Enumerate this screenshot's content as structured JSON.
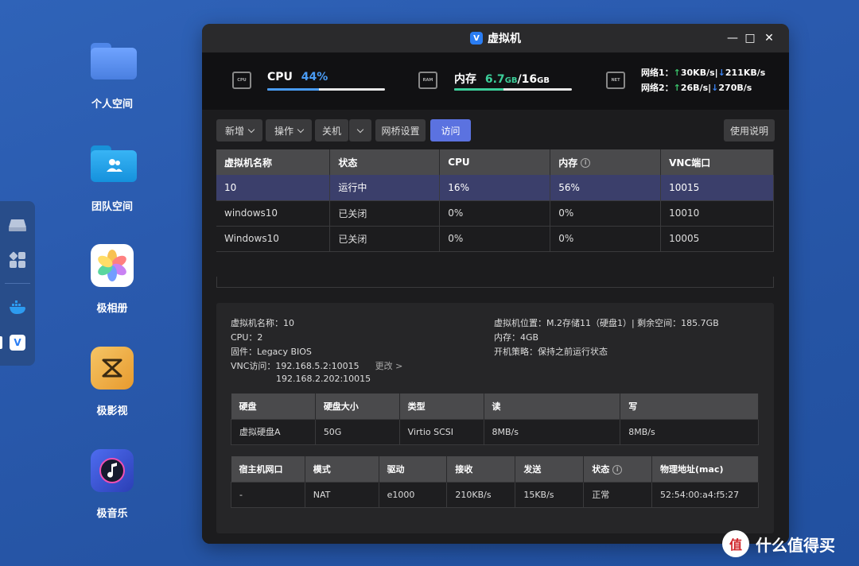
{
  "desktop": {
    "icons": [
      {
        "label": "个人空间",
        "icon": "folder-icon"
      },
      {
        "label": "团队空间",
        "icon": "team-folder-icon"
      },
      {
        "label": "极相册",
        "icon": "photos-icon"
      },
      {
        "label": "极影视",
        "icon": "video-icon"
      },
      {
        "label": "极音乐",
        "icon": "music-icon"
      }
    ]
  },
  "window": {
    "title": "虚拟机",
    "controls": {
      "minimize": "—",
      "maximize": "□",
      "close": "✕"
    }
  },
  "stats": {
    "cpu": {
      "label": "CPU",
      "value": "44%",
      "percent": 44,
      "chip": "CPU"
    },
    "memory": {
      "label": "内存",
      "used": "6.7",
      "used_unit": "GB",
      "sep": "/",
      "total": "16",
      "total_unit": "GB",
      "percent": 42,
      "chip": "RAM"
    },
    "network": {
      "chip": "NET",
      "net1": {
        "label": "网络1：",
        "up_arrow": "↑",
        "up": "30KB/s",
        "sep": "|",
        "down_arrow": "↓",
        "down": "211KB/s"
      },
      "net2": {
        "label": "网络2：",
        "up_arrow": "↑",
        "up": "26B/s",
        "sep": "|",
        "down_arrow": "↓",
        "down": "270B/s"
      }
    }
  },
  "toolbar": {
    "new": "新增",
    "action": "操作",
    "shutdown": "关机",
    "bridge": "网桥设置",
    "visit": "访问",
    "help": "使用说明"
  },
  "vm_table": {
    "headers": [
      "虚拟机名称",
      "状态",
      "CPU",
      "内存",
      "VNC端口"
    ],
    "rows": [
      [
        "10",
        "运行中",
        "16%",
        "56%",
        "10015"
      ],
      [
        "windows10",
        "已关闭",
        "0%",
        "0%",
        "10010"
      ],
      [
        "Windows10",
        "已关闭",
        "0%",
        "0%",
        "10005"
      ]
    ]
  },
  "detail": {
    "name": "虚拟机名称：10",
    "cpu": "CPU：2",
    "firmware": "固件：Legacy BIOS",
    "vnc": "VNC访问：192.168.5.2:10015",
    "vnc_change": "更改 >",
    "vnc2": "192.168.2.202:10015",
    "location": "虚拟机位置：M.2存储11（硬盘1）| 剩余空间：185.7GB",
    "memory": "内存：4GB",
    "boot": "开机策略：保持之前运行状态"
  },
  "disk_table": {
    "headers": [
      "硬盘",
      "硬盘大小",
      "类型",
      "读",
      "写"
    ],
    "rows": [
      [
        "虚拟硬盘A",
        "50G",
        "Virtio SCSI",
        "8MB/s",
        "8MB/s"
      ]
    ]
  },
  "net_table": {
    "headers": [
      "宿主机网口",
      "模式",
      "驱动",
      "接收",
      "发送",
      "状态",
      "物理地址(mac)"
    ],
    "rows": [
      [
        "-",
        "NAT",
        "e1000",
        "210KB/s",
        "15KB/s",
        "正常",
        "52:54:00:a4:f5:27"
      ]
    ]
  },
  "watermark": {
    "logo": "值",
    "text": "什么值得买"
  }
}
